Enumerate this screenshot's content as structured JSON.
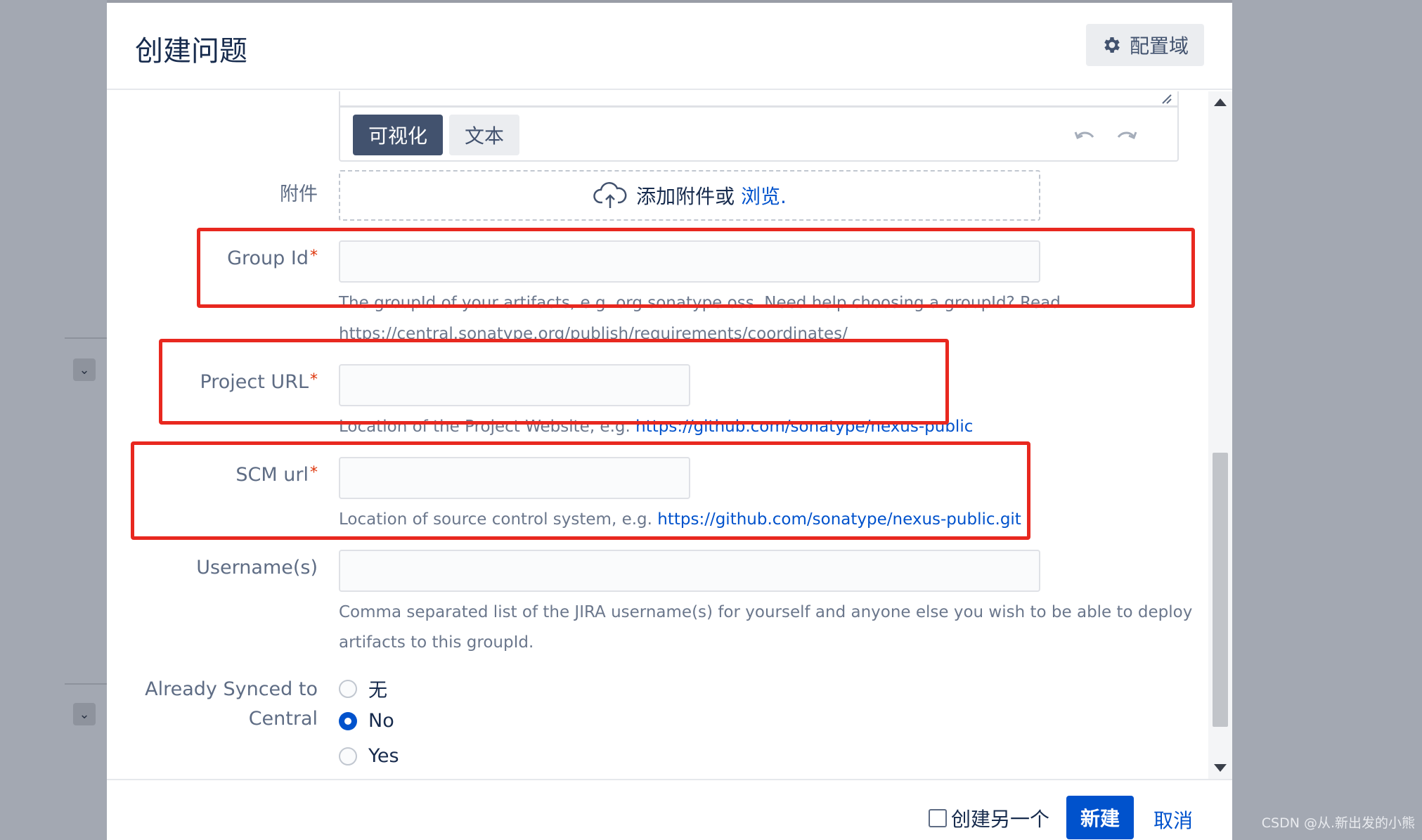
{
  "dialog": {
    "title": "创建问题",
    "config_label": "配置域"
  },
  "editor": {
    "modes": [
      "可视化",
      "文本"
    ],
    "active_mode": "可视化"
  },
  "attachment": {
    "label": "附件",
    "prompt": "添加附件或",
    "browse": "浏览."
  },
  "fields": {
    "group_id": {
      "label": "Group Id",
      "required": "*",
      "value": "",
      "help_line1": "The groupId of your artifacts, e.g. org.sonatype.oss. Need help choosing a groupId? Read",
      "help_link": "https://central.sonatype.org/publish/requirements/coordinates/"
    },
    "project_url": {
      "label": "Project URL",
      "required": "*",
      "value": "",
      "help_text": "Location of the Project Website, e.g. ",
      "help_link": "https://github.com/sonatype/nexus-public"
    },
    "scm_url": {
      "label": "SCM url",
      "required": "*",
      "value": "",
      "help_text": "Location of source control system, e.g. ",
      "help_link": "https://github.com/sonatype/nexus-public.git"
    },
    "usernames": {
      "label": "Username(s)",
      "value": "",
      "help_line1": "Comma separated list of the JIRA username(s) for yourself and anyone else you wish to be able to deploy",
      "help_line2": "artifacts to this groupId."
    },
    "already_synced": {
      "label_line1": "Already Synced to",
      "label_line2": "Central",
      "options": [
        "无",
        "No",
        "Yes"
      ],
      "selected": "No"
    }
  },
  "footer": {
    "create_another": "创建另一个",
    "create_button": "新建",
    "cancel": "取消"
  },
  "watermark": "CSDN @从.新出发的小熊",
  "colors": {
    "primary": "#0052cc",
    "highlight": "#e8281f",
    "required": "#de350b",
    "toolbar_active": "#42526e"
  }
}
